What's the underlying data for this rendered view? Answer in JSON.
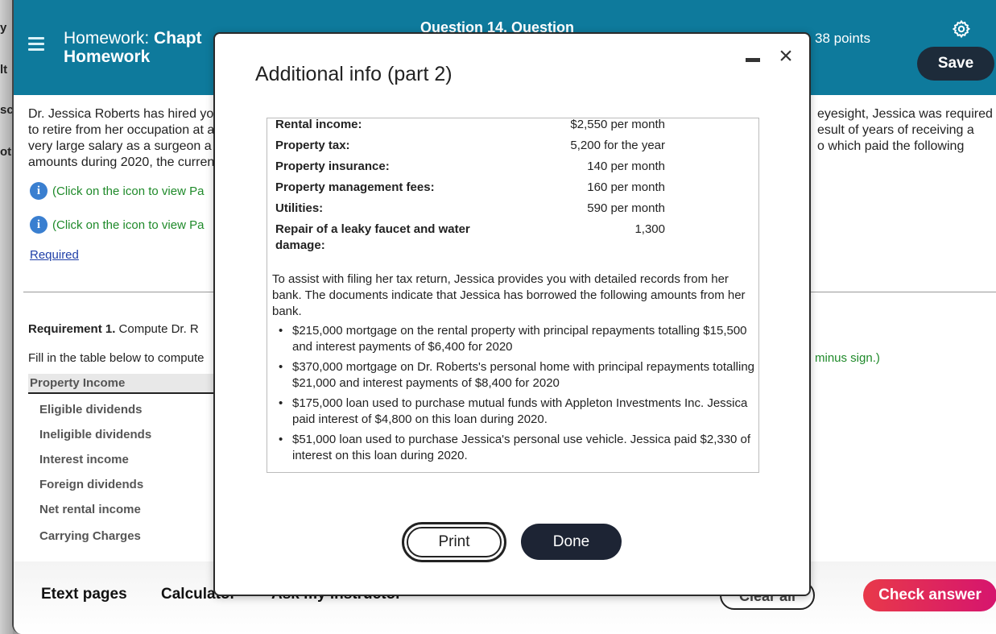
{
  "background_window": {
    "fragments": [
      "y",
      "lt",
      "sc",
      "ot"
    ]
  },
  "header": {
    "title_prefix": "Homework:",
    "title_bold": "Chapt",
    "title_line2": "Homework",
    "question_label": "Question 14, Question",
    "points": "38 points",
    "save_label": "Save",
    "settings_icon": "gear-icon",
    "menu_icon": "hamburger-icon"
  },
  "question": {
    "intro_lines": [
      "Dr. Jessica Roberts has hired yo",
      "to retire from her occupation at a",
      "very large salary as a surgeon a",
      "amounts during 2020, the curren"
    ],
    "intro_right_lines": [
      "eyesight, Jessica was required",
      "esult of years of receiving a",
      "o which paid the following"
    ],
    "info_links": [
      "(Click on the icon to view Pa",
      "(Click on the icon to view Pa"
    ],
    "required_label": "Required",
    "requirement_bold": "Requirement 1.",
    "requirement_text": " Compute Dr. R",
    "fill_text": "Fill in the table below to compute",
    "minus_text": "minus sign.)",
    "table_header": "Property Income",
    "table_rows": [
      "Eligible dividends",
      "Ineligible dividends",
      "Interest income",
      "Foreign dividends",
      "Net rental income",
      "Carrying Charges"
    ]
  },
  "footer": {
    "links": [
      "Etext pages",
      "Calculator",
      "Ask my instructor"
    ],
    "clear_all_label": "Clear all",
    "check_answer_label": "Check answer"
  },
  "modal": {
    "title": "Additional info (part 2)",
    "items": [
      {
        "label": "Rental income:",
        "value": "$2,550 per month"
      },
      {
        "label": "Property tax:",
        "value": "5,200 for the year"
      },
      {
        "label": "Property insurance:",
        "value": "140 per month"
      },
      {
        "label": "Property management fees:",
        "value": "160 per month"
      },
      {
        "label": "Utilities:",
        "value": "590 per month"
      },
      {
        "label": "Repair of a leaky faucet and water damage:",
        "value": "1,300"
      }
    ],
    "paragraph": "To assist with filing her tax return, Jessica provides you with detailed records from her bank. The documents indicate that Jessica has borrowed the following amounts from her bank.",
    "bullets": [
      "$215,000 mortgage on the rental property with principal repayments totalling $15,500 and interest payments of $6,400 for 2020",
      "$370,000 mortgage on Dr. Roberts's personal home with principal repayments totalling $21,000 and interest payments of $8,400 for 2020",
      "$175,000 loan used to purchase mutual funds with Appleton Investments Inc. Jessica paid interest of $4,800 on this loan during 2020.",
      "$51,000 loan used to purchase Jessica's personal use vehicle. Jessica paid $2,330 of interest on this loan during 2020."
    ],
    "print_label": "Print",
    "done_label": "Done"
  }
}
